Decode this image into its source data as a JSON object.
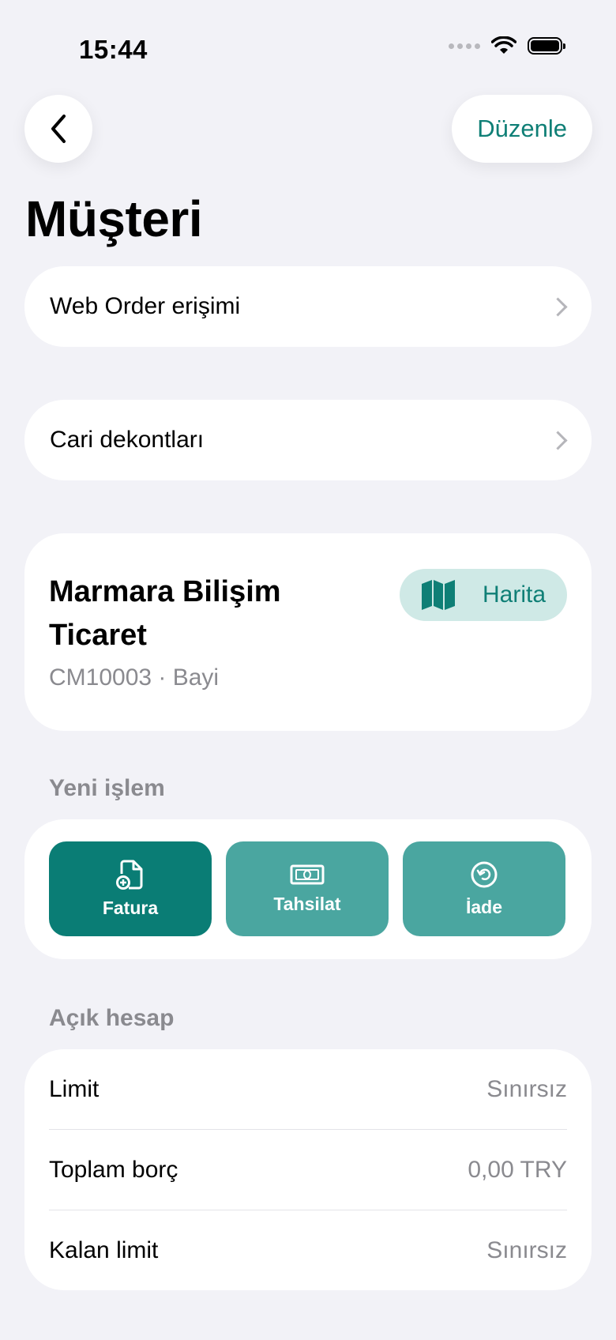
{
  "status_bar": {
    "time": "15:44"
  },
  "header": {
    "edit_label": "Düzenle",
    "title": "Müşteri"
  },
  "links": [
    {
      "label": "Web Order erişimi"
    },
    {
      "label": "Cari dekontları"
    }
  ],
  "customer": {
    "name": "Marmara Bilişim Ticaret",
    "subtitle": "CM10003 · Bayi",
    "map_label": "Harita"
  },
  "new_transaction": {
    "section_label": "Yeni işlem",
    "actions": [
      {
        "label": "Fatura",
        "icon": "add-document-icon"
      },
      {
        "label": "Tahsilat",
        "icon": "cash-icon"
      },
      {
        "label": "İade",
        "icon": "return-icon"
      }
    ]
  },
  "open_account": {
    "section_label": "Açık hesap",
    "rows": [
      {
        "label": "Limit",
        "value": "Sınırsız"
      },
      {
        "label": "Toplam borç",
        "value": "0,00 TRY"
      },
      {
        "label": "Kalan limit",
        "value": "Sınırsız"
      }
    ]
  },
  "colors": {
    "accent": "#0f7f76",
    "primary_action": "#0a7d75",
    "secondary_action": "#4aa6a0",
    "map_bg": "#cfe9e6",
    "background": "#f2f2f7"
  }
}
